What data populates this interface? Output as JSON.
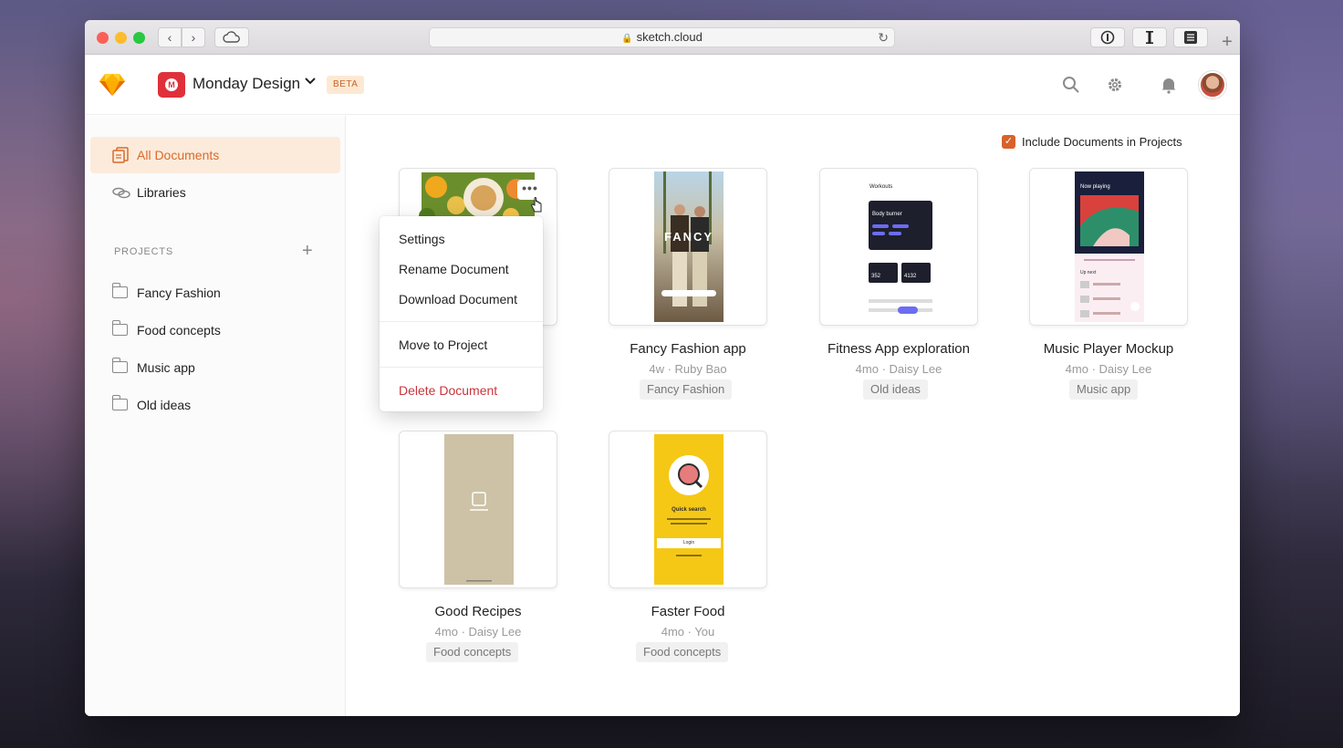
{
  "browser": {
    "url": "sketch.cloud",
    "nav_back": "‹",
    "nav_forward": "›"
  },
  "header": {
    "workspace_name": "Monday Design",
    "workspace_initial": "M",
    "beta_label": "BETA",
    "logo_color": "#fdb300",
    "workspace_color": "#e0303a"
  },
  "sidebar": {
    "all_documents": "All Documents",
    "libraries": "Libraries",
    "projects_label": "PROJECTS",
    "projects_add": "+",
    "projects": [
      {
        "label": "Fancy Fashion"
      },
      {
        "label": "Food concepts"
      },
      {
        "label": "Music app"
      },
      {
        "label": "Old ideas"
      }
    ]
  },
  "main": {
    "include_label": "Include Documents in Projects",
    "include_checked": true,
    "accent_color": "#d9612a",
    "documents": [
      {
        "title": "",
        "meta": "",
        "tag": ""
      },
      {
        "title": "Fancy Fashion app",
        "meta": "4w · Ruby Bao",
        "tag": "Fancy Fashion"
      },
      {
        "title": "Fitness App exploration",
        "meta": "4mo · Daisy Lee",
        "tag": "Old ideas"
      },
      {
        "title": "Music Player Mockup",
        "meta": "4mo · Daisy Lee",
        "tag": "Music app"
      },
      {
        "title": "Good Recipes",
        "meta": "4mo · Daisy Lee",
        "tag": "Food concepts"
      },
      {
        "title": "Faster Food",
        "meta": "4mo · You",
        "tag": "Food concepts"
      }
    ],
    "thumb_texts": {
      "fashion_brand": "FANCY",
      "fitness_header": "Workouts",
      "fitness_card": "Body burner",
      "fitness_stat_1": "352",
      "fitness_stat_2": "4132",
      "music_header": "Now playing",
      "music_up_next": "Up next",
      "faster_food_heading": "Quick search",
      "faster_food_login": "Login"
    }
  },
  "context_menu": {
    "more_label": "•••",
    "items": [
      {
        "label": "Settings"
      },
      {
        "label": "Rename Document"
      },
      {
        "label": "Download Document"
      },
      {
        "label": "Move to Project"
      },
      {
        "label": "Delete Document"
      }
    ],
    "danger_color": "#c8343a"
  }
}
